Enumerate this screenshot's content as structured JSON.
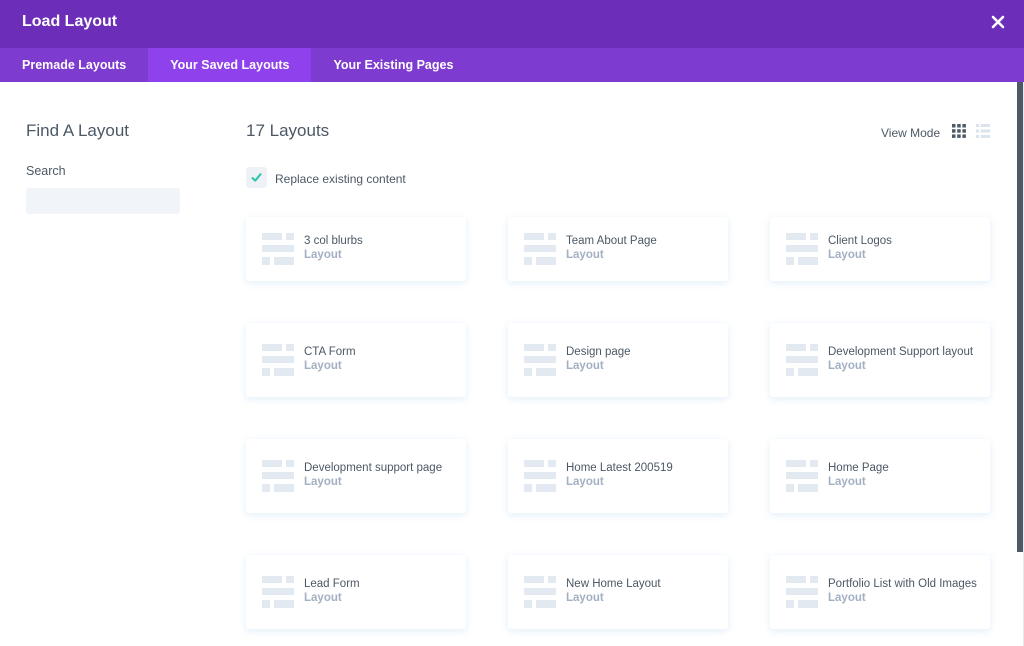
{
  "header": {
    "title": "Load Layout",
    "close_icon": "close-icon"
  },
  "tabs": [
    {
      "label": "Premade Layouts",
      "active": false
    },
    {
      "label": "Your Saved Layouts",
      "active": true
    },
    {
      "label": "Your Existing Pages",
      "active": false
    }
  ],
  "sidebar": {
    "title": "Find A Layout",
    "search_label": "Search",
    "search_value": "",
    "search_placeholder": ""
  },
  "main": {
    "count_label": "17 Layouts",
    "view_mode_label": "View Mode",
    "view_mode_selected": "grid",
    "replace_content": {
      "label": "Replace existing content",
      "checked": true
    },
    "layouts": [
      {
        "name": "3 col blurbs",
        "type": "Layout"
      },
      {
        "name": "Team About Page",
        "type": "Layout"
      },
      {
        "name": "Client Logos",
        "type": "Layout"
      },
      {
        "name": "CTA Form",
        "type": "Layout"
      },
      {
        "name": "Design page",
        "type": "Layout"
      },
      {
        "name": "Development Support layout",
        "type": "Layout"
      },
      {
        "name": "Development support page",
        "type": "Layout"
      },
      {
        "name": "Home Latest 200519",
        "type": "Layout"
      },
      {
        "name": "Home Page",
        "type": "Layout"
      },
      {
        "name": "Lead Form",
        "type": "Layout"
      },
      {
        "name": "New Home Layout",
        "type": "Layout"
      },
      {
        "name": "Portfolio List with Old Images",
        "type": "Layout"
      }
    ]
  },
  "colors": {
    "header_bg": "#6c2eb9",
    "tabs_bg": "#7e3bd0",
    "tab_active_bg": "#8f42ec",
    "checkmark": "#29c4a9",
    "text": "#4c5866",
    "subtext": "#a3b0c2"
  }
}
